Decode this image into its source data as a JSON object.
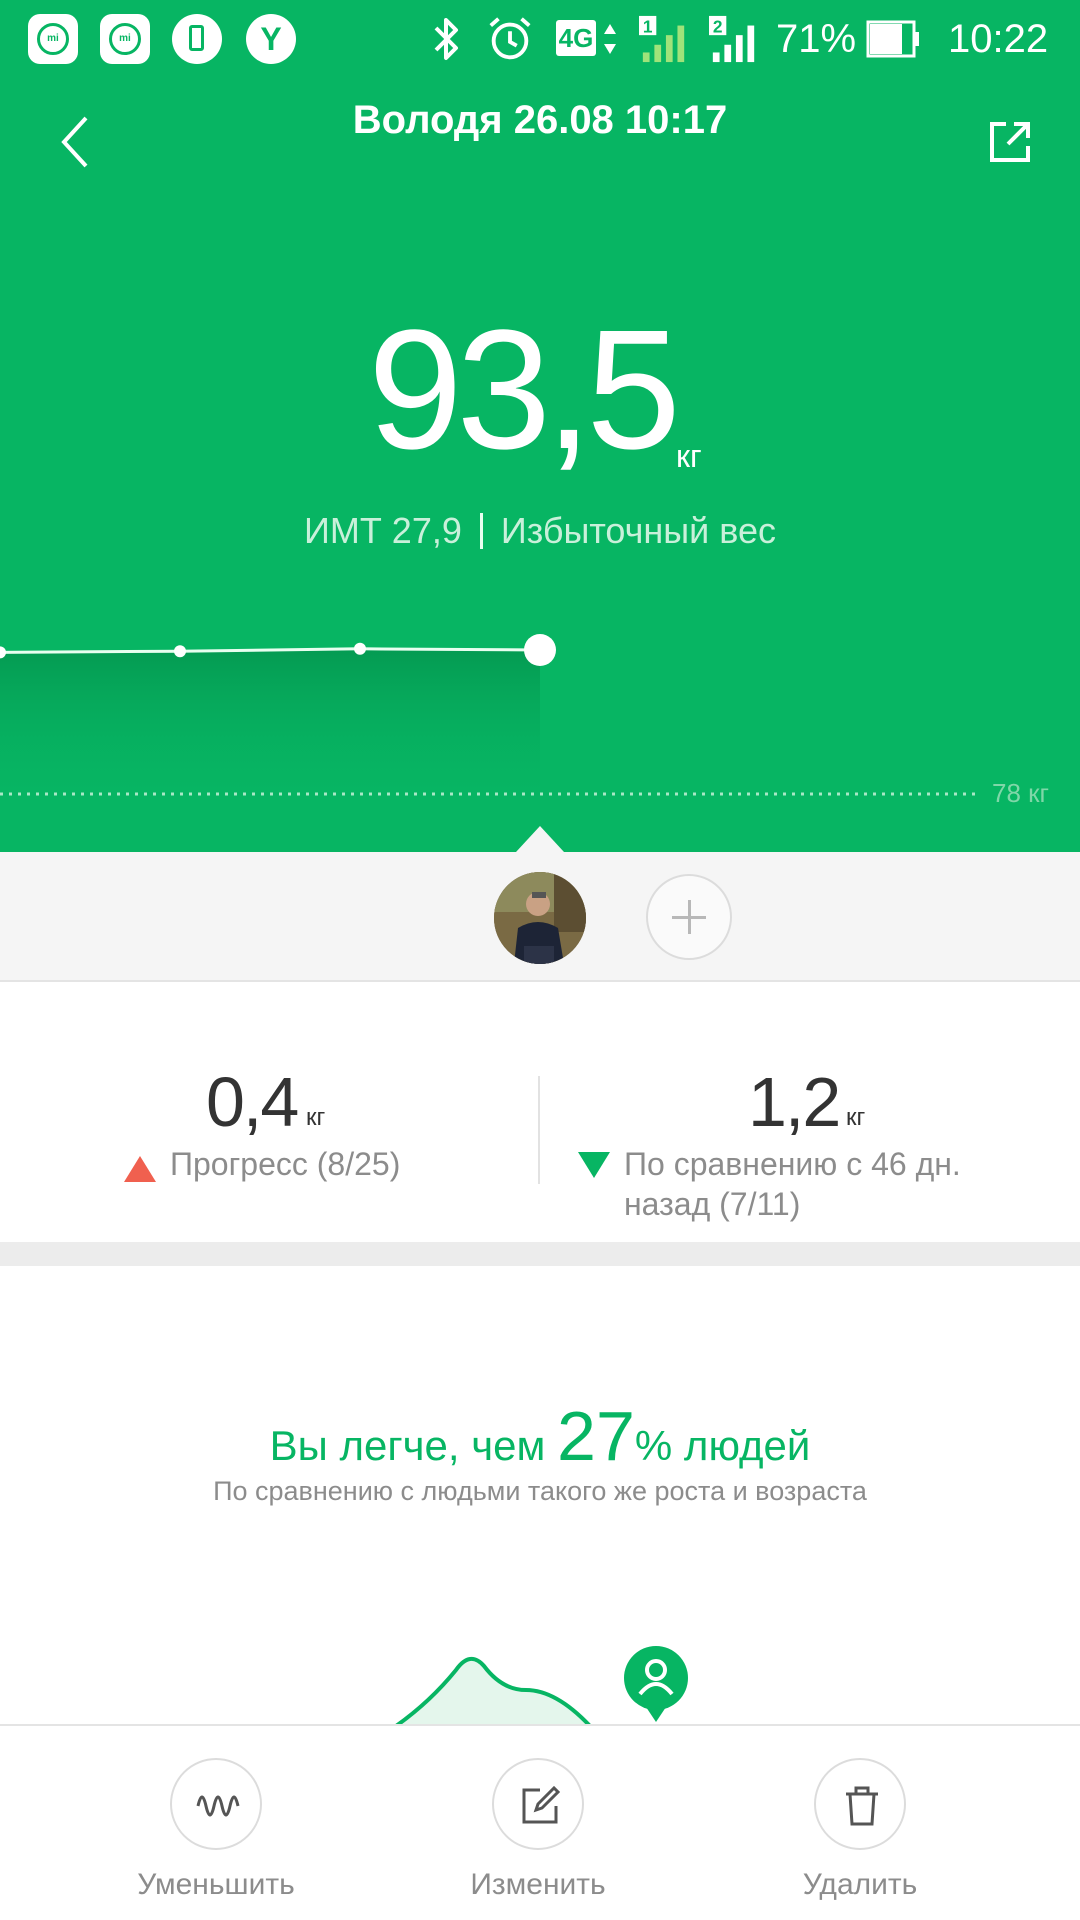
{
  "status_bar": {
    "network": "4G",
    "sim1": "1",
    "sim2": "2",
    "battery": "71%",
    "time": "10:22",
    "icons": [
      "mi-fit-icon",
      "mi-fit-icon",
      "battery-app-icon",
      "yandex-icon",
      "bluetooth-icon",
      "alarm-icon",
      "signal-icon",
      "battery-icon"
    ]
  },
  "header": {
    "title": "Володя 26.08 10:17",
    "back_icon": "chevron-left-icon",
    "share_icon": "share-icon"
  },
  "measurement": {
    "weight": "93,5",
    "unit": "кг",
    "bmi": "ИМТ 27,9",
    "status": "Избыточный вес"
  },
  "trend": {
    "target_label": "78 кг",
    "points": [
      93.3,
      93.4,
      93.6,
      93.5
    ]
  },
  "stats": {
    "left": {
      "value": "0,4",
      "unit": "кг",
      "label": "Прогресс (8/25)"
    },
    "right": {
      "value": "1,2",
      "unit": "кг",
      "label_line1": "По сравнению с 46 дн.",
      "label_line2": "назад (7/11)"
    }
  },
  "comparison": {
    "prefix": "Вы легче, чем ",
    "percent": "27",
    "suffix": "% людей",
    "subtitle": "По сравнению с людьми такого же роста и возраста"
  },
  "toolbar": {
    "decrease": "Уменьшить",
    "edit": "Изменить",
    "delete": "Удалить"
  },
  "colors": {
    "accent": "#07b563",
    "up": "#f0604f",
    "muted": "#8c8c8c"
  }
}
